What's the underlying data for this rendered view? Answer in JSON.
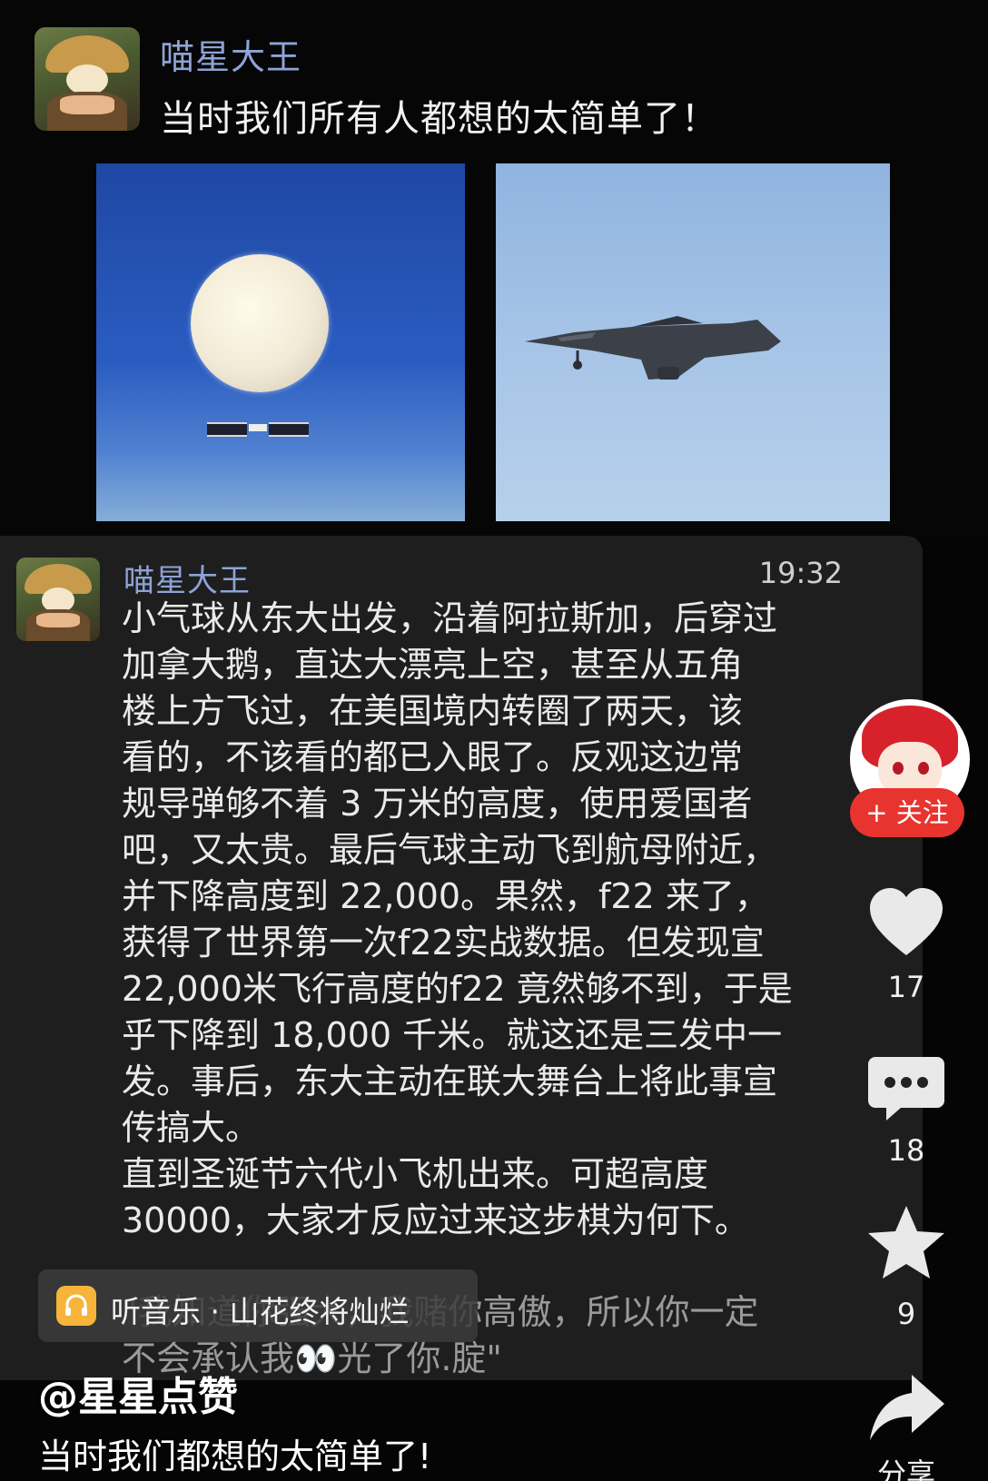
{
  "post": {
    "username": "喵星大王",
    "title": "当时我们所有人都想的太简单了！"
  },
  "comment": {
    "username": "喵星大王",
    "time": "19:32",
    "lines": [
      "小气球从东大出发，沿着阿拉斯加，后穿过",
      "加拿大鹅，直达大漂亮上空，甚至从五角",
      "楼上方飞过，在美国境内转圈了两天，该",
      "看的，不该看的都已入眼了。反观这边常",
      "规导弹够不着 3 万米的高度，使用爱国者",
      "吧，又太贵。最后气球主动飞到航母附近，",
      "并下降高度到 22,000。果然，f22 来了，",
      "获得了世界第一次f22实战数据。但发现宣",
      "22,000米飞行高度的f22 竟然够不到，于是",
      "乎下降到 18,000 千米。就这还是三发中一",
      "发。事后，东大主动在联大舞台上将此事宣",
      "传搞大。",
      "直到圣诞节六代小飞机出来。可超高度",
      "30000，大家才反应过来这步棋为何下。"
    ],
    "faded_lines": [
      "\"我知道你强大，我赌你高傲，所以你一定",
      "不会承认我👀光了你.腚\""
    ]
  },
  "music": {
    "icon": "headphones-icon",
    "text": "听音乐 · 山花终将灿烂"
  },
  "author": "@星星点赞",
  "caption": "当时我们都想的太简单了!",
  "actions": {
    "follow_label": "+ 关注",
    "like_count": "17",
    "comment_count": "18",
    "favorite_count": "9",
    "share_label": "分享"
  },
  "colors": {
    "username": "#8ea3d6",
    "follow": "#e8342f",
    "music_icon": "#f6b43a"
  }
}
